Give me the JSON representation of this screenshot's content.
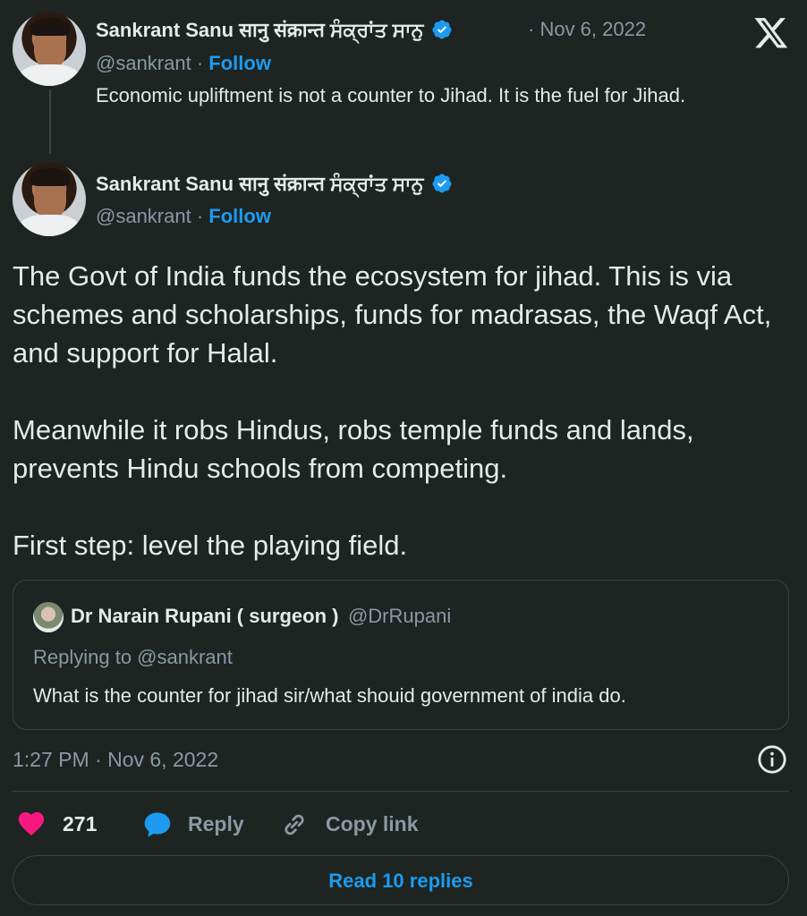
{
  "parent_tweet": {
    "author_name": "Sankrant Sanu सानु संक्रान्त ਸੰਕ੍ਰਾਂਤ ਸਾਨੁ",
    "handle": "@sankrant",
    "separator": " · ",
    "follow_label": "Follow",
    "date": "· Nov 6, 2022",
    "text": "Economic upliftment  is not a counter to Jihad. It is the fuel for Jihad."
  },
  "main_tweet": {
    "author_name": "Sankrant Sanu सानु संक्रान्त ਸੰਕ੍ਰਾਂਤ ਸਾਨੁ",
    "handle": "@sankrant",
    "separator": " · ",
    "follow_label": "Follow",
    "paragraphs": [
      "The Govt of India funds the ecosystem for jihad. This is via schemes and scholarships, funds for madrasas, the Waqf Act, and support for Halal.",
      "Meanwhile it robs Hindus, robs temple funds and lands, prevents Hindu schools from competing.",
      "First step: level the playing field."
    ],
    "timestamp": "1:27 PM · Nov 6, 2022"
  },
  "quoted_tweet": {
    "author_name": "Dr Narain Rupani ( surgeon )",
    "handle": "@DrRupani",
    "replying_to": "Replying to @sankrant",
    "text": "What is the counter for jihad sir/what shouid government of india do."
  },
  "actions": {
    "like_count": "271",
    "reply_label": "Reply",
    "copy_link_label": "Copy link",
    "read_replies_label": "Read 10 replies"
  },
  "icons": {
    "logo": "x-logo-icon",
    "verified": "verified-badge-icon",
    "info": "info-icon",
    "heart": "heart-icon",
    "reply": "speech-bubble-icon",
    "link": "link-icon"
  },
  "colors": {
    "background": "#1d2421",
    "accent": "#1d9bf0",
    "like": "#f91880",
    "text": "#e7e9ea",
    "muted": "#8b98a5"
  }
}
